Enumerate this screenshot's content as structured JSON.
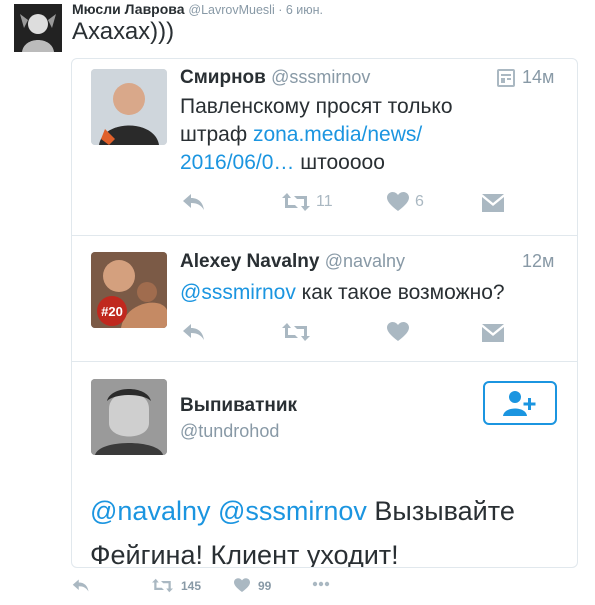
{
  "outer_tweet": {
    "name": "Мюсли Лаврова",
    "handle": "@LavrovMuesli",
    "dot": " · ",
    "time": "6 июн.",
    "text": "Ахахах)))",
    "actions": {
      "retweets": "145",
      "likes": "99"
    }
  },
  "tweets": [
    {
      "name": "Смирнов",
      "handle": "@sssmirnov",
      "time": "14м",
      "text_before": "Павленскому просят только штраф ",
      "link": "zona.media/news/ 2016/06/0…",
      "text_after": " штооооо",
      "retweets": "11",
      "likes": "6"
    },
    {
      "name": "Alexey Navalny",
      "handle": "@navalny",
      "time": "12м",
      "mention": "@sssmirnov",
      "text": " как такое возможно?",
      "badge": "#20"
    }
  ],
  "quoted_user": {
    "name": "Выпиватник",
    "handle": "@tundrohod",
    "mention1": "@navalny",
    "mention2": "@sssmirnov",
    "text": " Вызывайте Фейгина! Клиент уходит!"
  },
  "colors": {
    "accent": "#1b95e0",
    "muted": "#aab8c2",
    "text": "#292f33"
  }
}
